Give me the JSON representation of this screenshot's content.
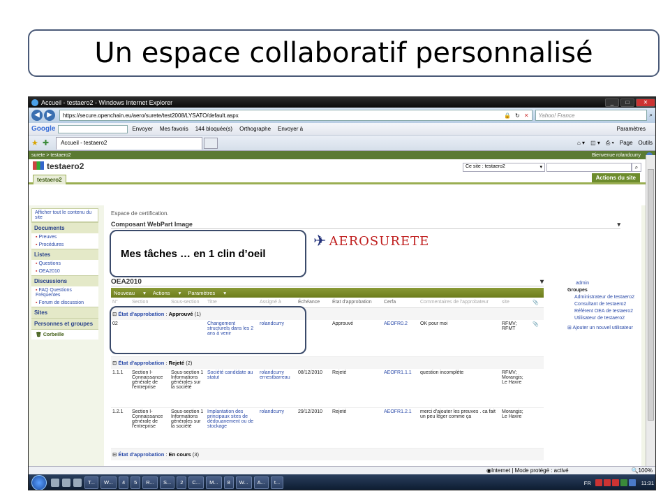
{
  "slide": {
    "title": "Un espace collaboratif personnalisé"
  },
  "browser": {
    "window_title": "Accueil - testaero2 - Windows Internet Explorer",
    "url": "https://secure.openchain.eu/aero/surete/test2008/LYSATO/default.aspx",
    "search_placeholder": "Yahoo! France",
    "google_label": "Google",
    "google_items": [
      "Envoyer",
      "Mes favoris",
      "144 bloquée(s)",
      "Orthographe",
      "Envoyer à",
      "Paramètres"
    ],
    "tab_title": "Accueil - testaero2",
    "page_menu": "Page",
    "tools_menu": "Outils"
  },
  "sharepoint": {
    "breadcrumb": "surete > testaero2",
    "welcome": "Bienvenue rolandcurry",
    "site_title": "testaero2",
    "site_tab": "testaero2",
    "search_scope": "Ce site : testaero2",
    "site_actions": "Actions du site",
    "quicklaunch": {
      "view_all": "Afficher tout le contenu du site",
      "sections": [
        {
          "title": "Documents",
          "items": [
            "Preuves",
            "Procédures"
          ]
        },
        {
          "title": "Listes",
          "items": [
            "Questions",
            "OEA2010"
          ]
        },
        {
          "title": "Discussions",
          "items": [
            "FAQ Questions Fréquentes",
            "Forum de discussion"
          ]
        },
        {
          "title": "Sites",
          "items": []
        },
        {
          "title": "Personnes et groupes",
          "items": []
        }
      ],
      "recycle_bin": "Corbeille"
    },
    "main": {
      "crumb": "Espace de certification.",
      "webpart_title": "Composant WebPart Image",
      "logo_text": "AEROSURETE",
      "callout": "Mes tâches … en 1 clin d’oeil",
      "list_title": "OEA2010",
      "toolbar": [
        "Nouveau",
        "Actions",
        "Paramètres"
      ],
      "columns": [
        "N°",
        "Section",
        "Sous-section",
        "Titre",
        "Assigné à",
        "Échéance",
        "État d'approbation",
        "Cerfa",
        "Commentaires de l'approbateur",
        "site",
        ""
      ],
      "groups": [
        {
          "label": "État d'approbation",
          "value": "Approuvé",
          "count": "(1)",
          "rows": [
            {
              "n": "02",
              "section": "",
              "subsection": "",
              "title": "Changement structurels dans les 2 ans à venir",
              "assigned": "rolandcurry",
              "due": "",
              "status": "Approuvé",
              "cerfa": "AEOFR0.2",
              "comment": "OK pour moi",
              "site": "RFMV; RFMT"
            }
          ]
        },
        {
          "label": "État d'approbation",
          "value": "Rejeté",
          "count": "(2)",
          "rows": [
            {
              "n": "1.1.1",
              "section": "Section I- Connaissance générale de l'entreprise",
              "subsection": "Sous-section 1 Informations générales sur la société",
              "title": "Société candidate au statut",
              "assigned": "rolandcurry ernestbarreau",
              "due": "08/12/2010",
              "status": "Rejeté",
              "cerfa": "AEOFR1.1.1",
              "comment": "question incomplète",
              "site": "RFMV; Morangis; Le Havre"
            },
            {
              "n": "1.2.1",
              "section": "Section I- Connaissance générale de l'entreprise",
              "subsection": "Sous-section 1 Informations générales sur la société",
              "title": "Implantation des principaux sites de dédouanement ou de stockage",
              "assigned": "rolandcurry",
              "due": "29/12/2010",
              "status": "Rejeté",
              "cerfa": "AEOFR1.2.1",
              "comment": "merci d'ajouter les preuves . ca fait un peu léger comme ça",
              "site": "Morangis; Le Havre"
            }
          ]
        },
        {
          "label": "État d'approbation",
          "value": "En cours",
          "count": "(3)",
          "rows": []
        }
      ]
    },
    "right": {
      "admin": "admin",
      "groups_header": "Groupes",
      "groups": [
        "Administrateur de testaero2",
        "Consultant de testaero2",
        "Référent OEA de testaero2",
        "Utilisateur de testaero2"
      ],
      "add_user": "Ajouter un nouvel utilisateur"
    }
  },
  "status": {
    "zone": "Internet | Mode protégé : activé",
    "zoom": "100%"
  },
  "taskbar": {
    "items": [
      "T...",
      "W...",
      "4",
      "5",
      "R...",
      "S...",
      "2",
      "C...",
      "M...",
      "8",
      "W...",
      "A...",
      "t..."
    ],
    "lang": "FR",
    "time": "11:31"
  }
}
